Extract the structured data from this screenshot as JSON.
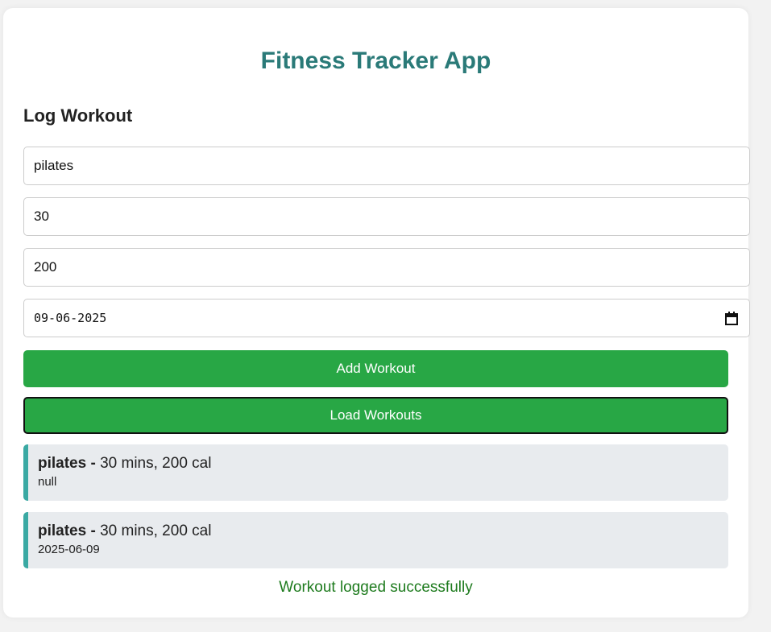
{
  "app": {
    "title": "Fitness Tracker App"
  },
  "form": {
    "section_title": "Log Workout",
    "exercise_value": "pilates",
    "duration_value": "30",
    "calories_value": "200",
    "date_value": "09-06-2025",
    "add_button_label": "Add Workout",
    "load_button_label": "Load Workouts"
  },
  "workouts": [
    {
      "name": "pilates",
      "separator": " - ",
      "details": "30 mins, 200 cal",
      "date": "null"
    },
    {
      "name": "pilates",
      "separator": " - ",
      "details": "30 mins, 200 cal",
      "date": "2025-06-09"
    }
  ],
  "status": {
    "message": "Workout logged successfully"
  },
  "colors": {
    "accent": "#2a7a78",
    "button": "#28a745",
    "item_border": "#3aa9a3",
    "success_text": "#1e7b1e"
  },
  "icons": {
    "date_picker": "calendar-icon"
  }
}
